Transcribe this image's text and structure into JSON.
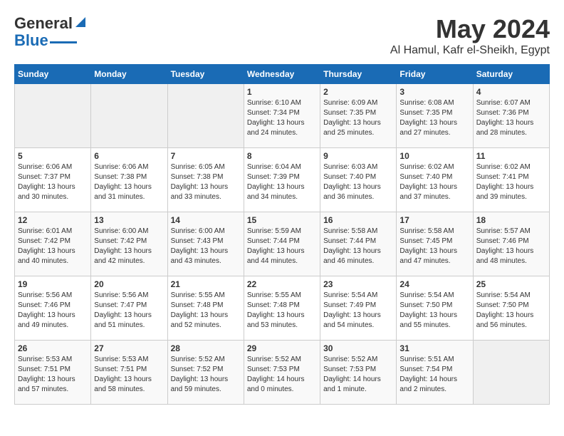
{
  "header": {
    "logo_general": "General",
    "logo_blue": "Blue",
    "month": "May 2024",
    "location": "Al Hamul, Kafr el-Sheikh, Egypt"
  },
  "weekdays": [
    "Sunday",
    "Monday",
    "Tuesday",
    "Wednesday",
    "Thursday",
    "Friday",
    "Saturday"
  ],
  "weeks": [
    [
      {
        "day": "",
        "info": ""
      },
      {
        "day": "",
        "info": ""
      },
      {
        "day": "",
        "info": ""
      },
      {
        "day": "1",
        "info": "Sunrise: 6:10 AM\nSunset: 7:34 PM\nDaylight: 13 hours\nand 24 minutes."
      },
      {
        "day": "2",
        "info": "Sunrise: 6:09 AM\nSunset: 7:35 PM\nDaylight: 13 hours\nand 25 minutes."
      },
      {
        "day": "3",
        "info": "Sunrise: 6:08 AM\nSunset: 7:35 PM\nDaylight: 13 hours\nand 27 minutes."
      },
      {
        "day": "4",
        "info": "Sunrise: 6:07 AM\nSunset: 7:36 PM\nDaylight: 13 hours\nand 28 minutes."
      }
    ],
    [
      {
        "day": "5",
        "info": "Sunrise: 6:06 AM\nSunset: 7:37 PM\nDaylight: 13 hours\nand 30 minutes."
      },
      {
        "day": "6",
        "info": "Sunrise: 6:06 AM\nSunset: 7:38 PM\nDaylight: 13 hours\nand 31 minutes."
      },
      {
        "day": "7",
        "info": "Sunrise: 6:05 AM\nSunset: 7:38 PM\nDaylight: 13 hours\nand 33 minutes."
      },
      {
        "day": "8",
        "info": "Sunrise: 6:04 AM\nSunset: 7:39 PM\nDaylight: 13 hours\nand 34 minutes."
      },
      {
        "day": "9",
        "info": "Sunrise: 6:03 AM\nSunset: 7:40 PM\nDaylight: 13 hours\nand 36 minutes."
      },
      {
        "day": "10",
        "info": "Sunrise: 6:02 AM\nSunset: 7:40 PM\nDaylight: 13 hours\nand 37 minutes."
      },
      {
        "day": "11",
        "info": "Sunrise: 6:02 AM\nSunset: 7:41 PM\nDaylight: 13 hours\nand 39 minutes."
      }
    ],
    [
      {
        "day": "12",
        "info": "Sunrise: 6:01 AM\nSunset: 7:42 PM\nDaylight: 13 hours\nand 40 minutes."
      },
      {
        "day": "13",
        "info": "Sunrise: 6:00 AM\nSunset: 7:42 PM\nDaylight: 13 hours\nand 42 minutes."
      },
      {
        "day": "14",
        "info": "Sunrise: 6:00 AM\nSunset: 7:43 PM\nDaylight: 13 hours\nand 43 minutes."
      },
      {
        "day": "15",
        "info": "Sunrise: 5:59 AM\nSunset: 7:44 PM\nDaylight: 13 hours\nand 44 minutes."
      },
      {
        "day": "16",
        "info": "Sunrise: 5:58 AM\nSunset: 7:44 PM\nDaylight: 13 hours\nand 46 minutes."
      },
      {
        "day": "17",
        "info": "Sunrise: 5:58 AM\nSunset: 7:45 PM\nDaylight: 13 hours\nand 47 minutes."
      },
      {
        "day": "18",
        "info": "Sunrise: 5:57 AM\nSunset: 7:46 PM\nDaylight: 13 hours\nand 48 minutes."
      }
    ],
    [
      {
        "day": "19",
        "info": "Sunrise: 5:56 AM\nSunset: 7:46 PM\nDaylight: 13 hours\nand 49 minutes."
      },
      {
        "day": "20",
        "info": "Sunrise: 5:56 AM\nSunset: 7:47 PM\nDaylight: 13 hours\nand 51 minutes."
      },
      {
        "day": "21",
        "info": "Sunrise: 5:55 AM\nSunset: 7:48 PM\nDaylight: 13 hours\nand 52 minutes."
      },
      {
        "day": "22",
        "info": "Sunrise: 5:55 AM\nSunset: 7:48 PM\nDaylight: 13 hours\nand 53 minutes."
      },
      {
        "day": "23",
        "info": "Sunrise: 5:54 AM\nSunset: 7:49 PM\nDaylight: 13 hours\nand 54 minutes."
      },
      {
        "day": "24",
        "info": "Sunrise: 5:54 AM\nSunset: 7:50 PM\nDaylight: 13 hours\nand 55 minutes."
      },
      {
        "day": "25",
        "info": "Sunrise: 5:54 AM\nSunset: 7:50 PM\nDaylight: 13 hours\nand 56 minutes."
      }
    ],
    [
      {
        "day": "26",
        "info": "Sunrise: 5:53 AM\nSunset: 7:51 PM\nDaylight: 13 hours\nand 57 minutes."
      },
      {
        "day": "27",
        "info": "Sunrise: 5:53 AM\nSunset: 7:51 PM\nDaylight: 13 hours\nand 58 minutes."
      },
      {
        "day": "28",
        "info": "Sunrise: 5:52 AM\nSunset: 7:52 PM\nDaylight: 13 hours\nand 59 minutes."
      },
      {
        "day": "29",
        "info": "Sunrise: 5:52 AM\nSunset: 7:53 PM\nDaylight: 14 hours\nand 0 minutes."
      },
      {
        "day": "30",
        "info": "Sunrise: 5:52 AM\nSunset: 7:53 PM\nDaylight: 14 hours\nand 1 minute."
      },
      {
        "day": "31",
        "info": "Sunrise: 5:51 AM\nSunset: 7:54 PM\nDaylight: 14 hours\nand 2 minutes."
      },
      {
        "day": "",
        "info": ""
      }
    ]
  ]
}
